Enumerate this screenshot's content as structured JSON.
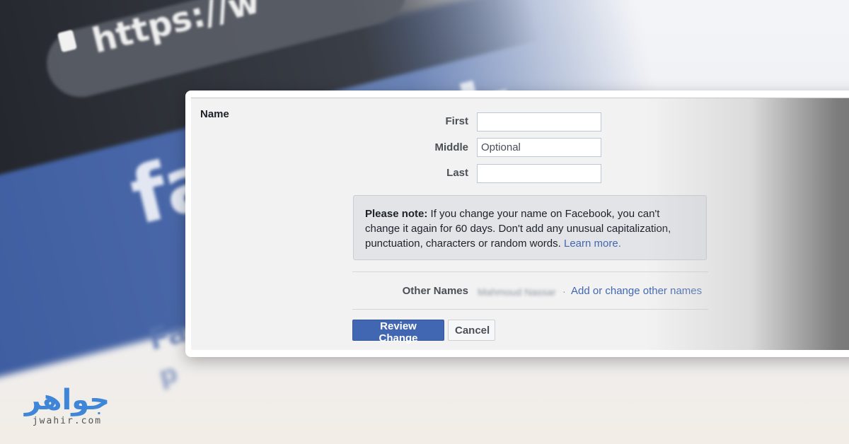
{
  "background": {
    "url_text": "https://w",
    "brand_text": "facebook",
    "line1": "Fa",
    "line2": "p"
  },
  "form": {
    "section_title": "Name",
    "fields": {
      "first": {
        "label": "First",
        "value": "",
        "placeholder": ""
      },
      "middle": {
        "label": "Middle",
        "value": "",
        "placeholder": "Optional"
      },
      "last": {
        "label": "Last",
        "value": "",
        "placeholder": ""
      }
    },
    "note": {
      "bold": "Please note:",
      "text": " If you change your name on Facebook, you can't change it again for 60 days. Don't add any unusual capitalization, punctuation, characters or random words. ",
      "link": "Learn more."
    },
    "other_names": {
      "label": "Other Names",
      "value": "Mahmoud Nassar",
      "separator": "·",
      "link": "Add or change other names"
    },
    "buttons": {
      "review": "Review Change",
      "cancel": "Cancel"
    }
  },
  "colors": {
    "facebook_blue": "#4267b2",
    "logo_blue": "#3f86d9"
  },
  "watermark": {
    "arabic": "جواهر",
    "domain": "jwahir.com"
  }
}
